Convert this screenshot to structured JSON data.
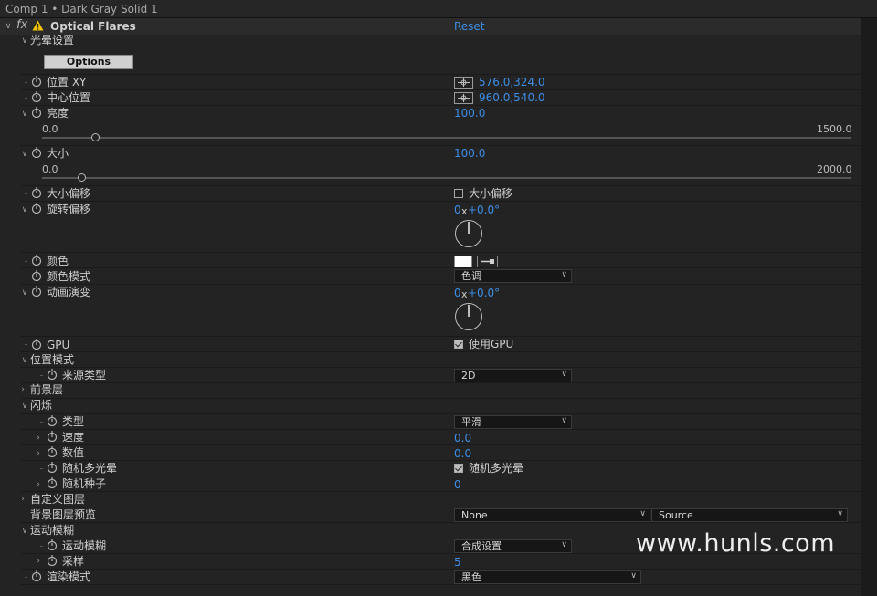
{
  "window": {
    "title": "Comp 1 • Dark Gray Solid 1"
  },
  "effect": {
    "fx": "fx",
    "name": "Optical Flares",
    "reset": "Reset"
  },
  "props": {
    "flare_settings": "光晕设置",
    "options": "Options",
    "position_xy": {
      "label": "位置 XY",
      "value": "576.0,324.0"
    },
    "center_position": {
      "label": "中心位置",
      "value": "960.0,540.0"
    },
    "brightness": {
      "label": "亮度",
      "value": "100.0",
      "min": "0.0",
      "max": "1500.0",
      "level": 100,
      "range": 1500
    },
    "scale": {
      "label": "大小",
      "value": "100.0",
      "min": "0.0",
      "max": "2000.0",
      "level": 100,
      "range": 2000
    },
    "scale_offset": {
      "label": "大小偏移",
      "checkbox_label": "大小偏移",
      "checked": false
    },
    "rotation_offset": {
      "label": "旋转偏移",
      "revs": "0",
      "x": "x",
      "deg": "+0.0°"
    },
    "color": {
      "label": "颜色",
      "swatch": "#ffffff"
    },
    "color_mode": {
      "label": "颜色模式",
      "value": "色调"
    },
    "animation_evolution": {
      "label": "动画演变",
      "revs": "0",
      "x": "x",
      "deg": "+0.0°"
    },
    "gpu": {
      "label": "GPU",
      "checkbox_label": "使用GPU",
      "checked": true
    },
    "positioning_mode": {
      "label": "位置模式"
    },
    "source_type": {
      "label": "来源类型",
      "value": "2D"
    },
    "foreground_layers": {
      "label": "前景层"
    },
    "flicker": {
      "label": "闪烁"
    },
    "flicker_type": {
      "label": "类型",
      "value": "平滑"
    },
    "flicker_speed": {
      "label": "速度",
      "value": "0.0"
    },
    "flicker_amount": {
      "label": "数值",
      "value": "0.0"
    },
    "random_flares": {
      "label": "随机多光晕",
      "checkbox_label": "随机多光晕",
      "checked": true
    },
    "random_seed": {
      "label": "随机种子",
      "value": "0"
    },
    "custom_layers": {
      "label": "自定义图层"
    },
    "bg_preview": {
      "label": "背景图层预览",
      "value1": "None",
      "value2": "Source"
    },
    "motion_blur_group": {
      "label": "运动模糊"
    },
    "motion_blur": {
      "label": "运动模糊",
      "value": "合成设置"
    },
    "samples": {
      "label": "采样",
      "value": "5"
    },
    "render_mode": {
      "label": "渲染模式",
      "value": "黑色"
    }
  },
  "watermark": "www.hunls.com",
  "colors": {
    "value_blue": "#3d8ee6",
    "panel": "#232323"
  }
}
